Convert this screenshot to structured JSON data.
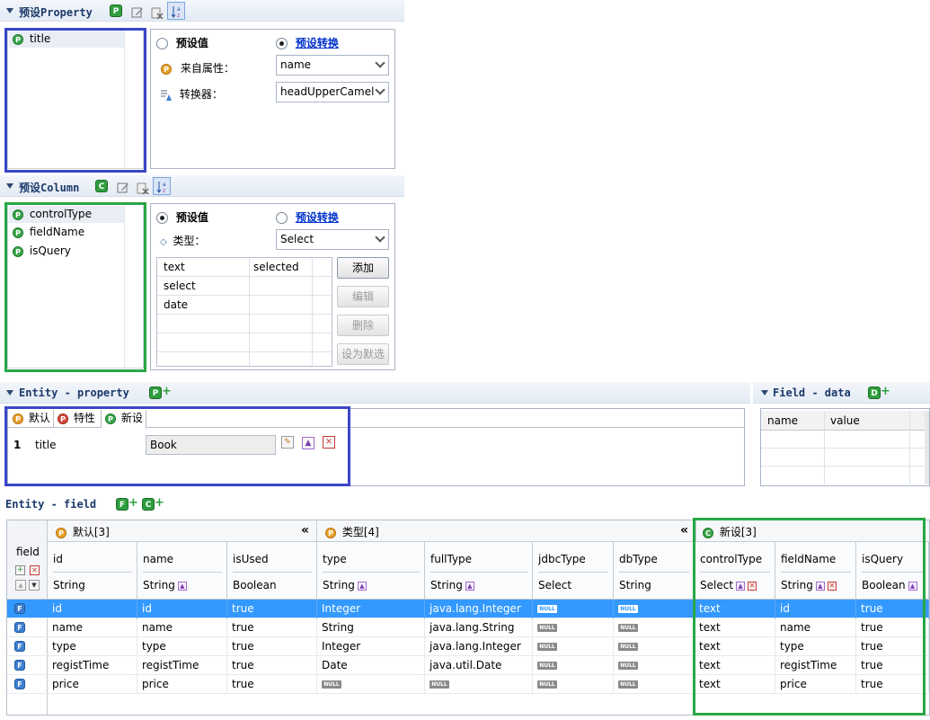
{
  "preset_property": {
    "title": "预设Property",
    "list": [
      "title"
    ],
    "radio_value": "预设值",
    "radio_convert": "预设转换",
    "from_attr_label": "来自属性：",
    "from_attr_value": "name",
    "converter_label": "转换器：",
    "converter_value": "headUpperCamel"
  },
  "preset_column": {
    "title": "预设Column",
    "list": [
      "controlType",
      "fieldName",
      "isQuery"
    ],
    "radio_value": "预设值",
    "radio_convert": "预设转换",
    "type_label": "类型：",
    "type_value": "Select",
    "options_table": {
      "headers": [
        "text",
        "selected"
      ],
      "rows": [
        [
          "select",
          ""
        ],
        [
          "date",
          ""
        ]
      ]
    },
    "buttons": {
      "add": "添加",
      "edit": "编辑",
      "delete": "删除",
      "set_default": "设为默选"
    }
  },
  "entity_property": {
    "title": "Entity - property",
    "tabs": [
      "默认",
      "特性",
      "新设"
    ],
    "row_index": "1",
    "row_name": "title",
    "row_value": "Book"
  },
  "field_data": {
    "title": "Field - data",
    "headers": [
      "name",
      "value"
    ]
  },
  "entity_field": {
    "title": "Entity - field",
    "group_default": "默认[3]",
    "group_type": "类型[4]",
    "group_new": "新设[3]",
    "collapse_glyph": "«",
    "row_header": "field",
    "columns": [
      {
        "name": "id",
        "type": "String"
      },
      {
        "name": "name",
        "type": "String"
      },
      {
        "name": "isUsed",
        "type": "Boolean"
      },
      {
        "name": "type",
        "type": "String"
      },
      {
        "name": "fullType",
        "type": "String"
      },
      {
        "name": "jdbcType",
        "type": "Select"
      },
      {
        "name": "dbType",
        "type": "String"
      },
      {
        "name": "controlType",
        "type": "Select"
      },
      {
        "name": "fieldName",
        "type": "String"
      },
      {
        "name": "isQuery",
        "type": "Boolean"
      }
    ],
    "rows": [
      [
        "id",
        "id",
        "true",
        "Integer",
        "java.lang.Integer",
        "NULL",
        "NULL",
        "text",
        "id",
        "true"
      ],
      [
        "name",
        "name",
        "true",
        "String",
        "java.lang.String",
        "NULL",
        "NULL",
        "text",
        "name",
        "true"
      ],
      [
        "type",
        "type",
        "true",
        "Integer",
        "java.lang.Integer",
        "NULL",
        "NULL",
        "text",
        "type",
        "true"
      ],
      [
        "registTime",
        "registTime",
        "true",
        "Date",
        "java.util.Date",
        "NULL",
        "NULL",
        "text",
        "registTime",
        "true"
      ],
      [
        "price",
        "price",
        "true",
        "NULL",
        "NULL",
        "NULL",
        "NULL",
        "text",
        "price",
        "true"
      ]
    ],
    "null_text": "NULL"
  },
  "colors": {
    "blue_highlight": "#3b46c8",
    "green_highlight": "#28a745",
    "selected_row": "#3399ff"
  }
}
